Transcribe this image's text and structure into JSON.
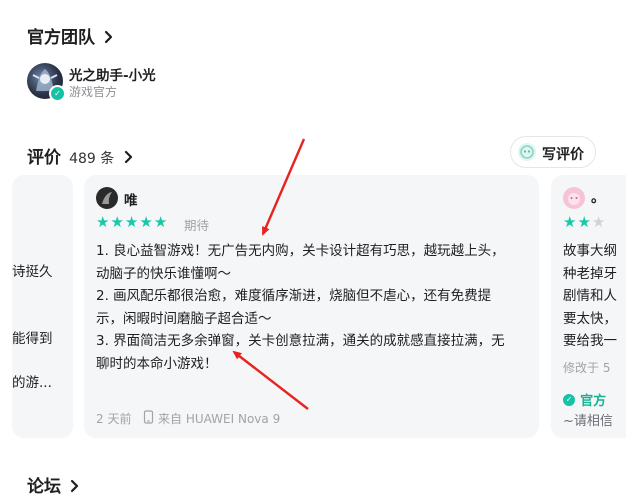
{
  "team": {
    "title": "官方团队",
    "member_name": "光之助手-小光",
    "member_role": "游戏官方"
  },
  "reviews": {
    "title": "评价",
    "count": "489 条",
    "write_label": "写评价",
    "left_card": {
      "line1": "诗挺久",
      "line2": "能得到",
      "line3": "的游..."
    },
    "main_card": {
      "author": "唯",
      "rating": 5,
      "tag": "期待",
      "lines": [
        "1. 良心益智游戏！无广告无内购，关卡设计超有巧思，越玩越上头，",
        "动脑子的快乐谁懂啊～",
        "2. 画风配乐都很治愈，难度循序渐进，烧脑但不虐心，还有免费提",
        "示，闲暇时间磨脑子超合适～",
        "3. 界面简洁无多余弹窗，关卡创意拉满，通关的成就感直接拉满，无",
        "聊时的本命小游戏！"
      ],
      "time": "2 天前",
      "device": "来自 HUAWEI Nova 9"
    },
    "right_card": {
      "author": "。",
      "rating": 2,
      "lines": [
        "故事大纲",
        "种老掉牙",
        "剧情和人",
        "要太快，",
        "要给我一"
      ],
      "modified": "修改于 5",
      "official_label": "官方",
      "official_reply": "~请相信"
    }
  },
  "forum": {
    "title": "论坛"
  },
  "colors": {
    "accent": "#18c9a8",
    "annotation_arrow": "#e8231f"
  },
  "icons": [
    "chevron-right-icon",
    "verified-icon",
    "write-review-icon",
    "phone-icon",
    "star-icon"
  ]
}
